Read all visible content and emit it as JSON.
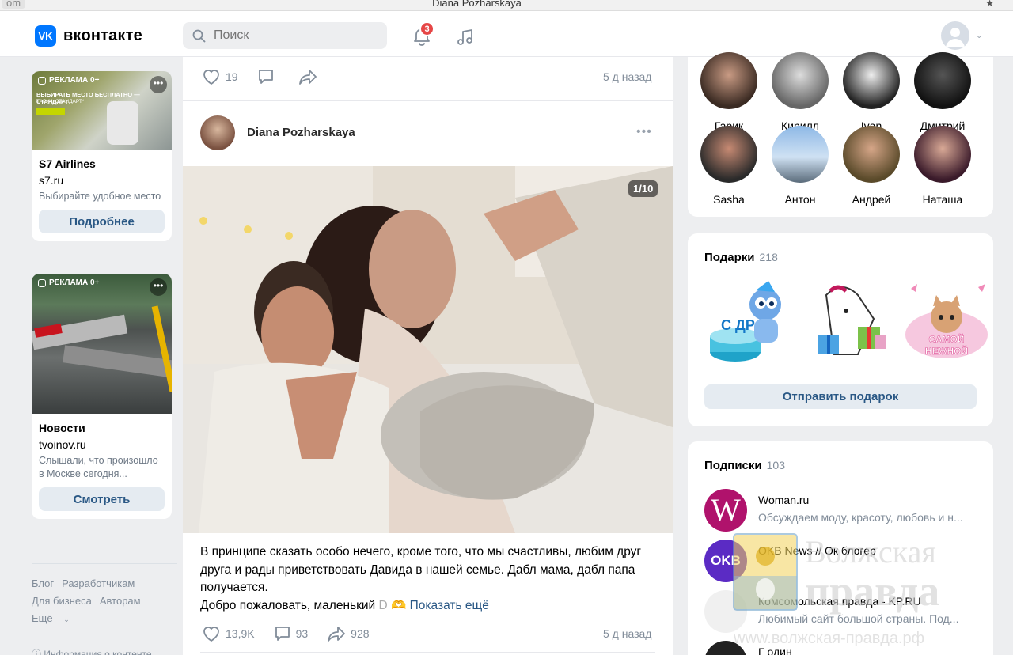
{
  "titlebar": {
    "left_text": "om",
    "title": "Diana Pozharskaya",
    "star": "★"
  },
  "topbar": {
    "logo_mark": "VK",
    "logo_text": "вконтакте",
    "search_placeholder": "Поиск",
    "notifications_count": "3"
  },
  "ads": [
    {
      "tag": "РЕКЛАМА 0+",
      "banner_line1": "ВЫБИРАТЬ МЕСТО БЕСПЛАТНО — СТАНДАРТ",
      "banner_line2": "ТАРИФ СТАНДАРТ*",
      "title": "S7 Airlines",
      "domain": "s7.ru",
      "text": "Выбирайте удобное место",
      "button": "Подробнее"
    },
    {
      "tag": "РЕКЛАМА 0+",
      "title": "Новости",
      "domain": "tvoinov.ru",
      "text": "Слышали, что произошло в Москве сегодня...",
      "button": "Смотреть"
    }
  ],
  "footer": {
    "links": [
      "Блог",
      "Разработчикам",
      "Для бизнеса",
      "Авторам",
      "Ещё"
    ],
    "info": "Информация о контенте"
  },
  "feed": {
    "prev_post": {
      "likes": "19",
      "time": "5 д назад"
    },
    "post": {
      "author": "Diana Pozharskaya",
      "photo_counter": "1/10",
      "text_line1": "В принципе сказать особо нечего, кроме того, что мы счастливы, любим друг друга и рады приветствовать Давида в нашей семье. Дабл мама, дабл папа получается.",
      "text_line2": "Добро пожаловать, маленький",
      "text_d": "D",
      "show_more": "Показать ещё",
      "likes": "13,9K",
      "comments": "93",
      "shares": "928",
      "time": "5 д назад"
    }
  },
  "friends": [
    {
      "name": "Гарик",
      "color": "#5a4a3e"
    },
    {
      "name": "Кирилл",
      "color": "#8b8b8b"
    },
    {
      "name": "Ivan",
      "color": "#3a3a3a"
    },
    {
      "name": "Дмитрий",
      "color": "#1a1a1a"
    },
    {
      "name": "Sasha",
      "color": "#6b3a3a"
    },
    {
      "name": "Антон",
      "color": "#7aa7d8"
    },
    {
      "name": "Андрей",
      "color": "#6b5a3a"
    },
    {
      "name": "Наташа",
      "color": "#4a2a3a"
    }
  ],
  "gifts": {
    "title": "Подарки",
    "count": "218",
    "gift3_text": "САМОЙ НЕЖНОЙ",
    "gift1_text": "С ДР",
    "button": "Отправить подарок"
  },
  "subscriptions": {
    "title": "Подписки",
    "count": "103",
    "items": [
      {
        "name": "Woman.ru",
        "desc": "Обсуждаем моду, красоту, любовь и н...",
        "logo": "W",
        "color": "#b0126c"
      },
      {
        "name": "OKB News // Ок блогер",
        "desc": "",
        "logo": "OKB",
        "color": "#5b2bc4"
      },
      {
        "name": "Комсомольская правда - KP.RU",
        "desc": "Любимый сайт большой страны. Под...",
        "logo": "",
        "color": "#eeeeee"
      },
      {
        "name": "Г один",
        "desc": "",
        "logo": "",
        "color": "#222222"
      }
    ]
  },
  "watermark": {
    "line1": "Волжская",
    "line2": "правда",
    "url": "www.волжская-правда.рф"
  }
}
